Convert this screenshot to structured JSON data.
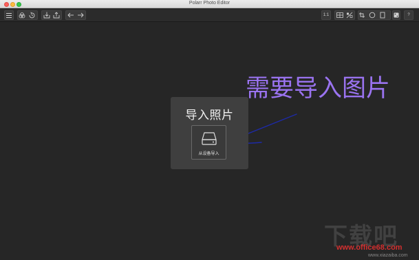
{
  "window": {
    "title": "Polarr Photo Editor"
  },
  "toolbar": {
    "left_icons": [
      "menu-icon",
      "filters-icon",
      "history-icon",
      "import-icon",
      "export-icon",
      "undo-icon",
      "redo-icon"
    ],
    "zoom_label": "1:1",
    "right_icons": [
      "compare-icon",
      "split-compare-icon",
      "crop-icon",
      "circle-mask-icon",
      "rect-mask-icon",
      "random-icon",
      "help-icon"
    ],
    "help_label": "?"
  },
  "import_panel": {
    "title": "导入照片",
    "button_label": "从设备导入",
    "button_icon": "drive-icon"
  },
  "annotation": {
    "text": "需要导入图片",
    "color": "#9a73f0",
    "arrow_color": "#1d2aa8"
  },
  "watermark": {
    "logo_text": "下载吧",
    "url": "www.office68.com",
    "sub_url": "www.xiazaiba.com"
  }
}
